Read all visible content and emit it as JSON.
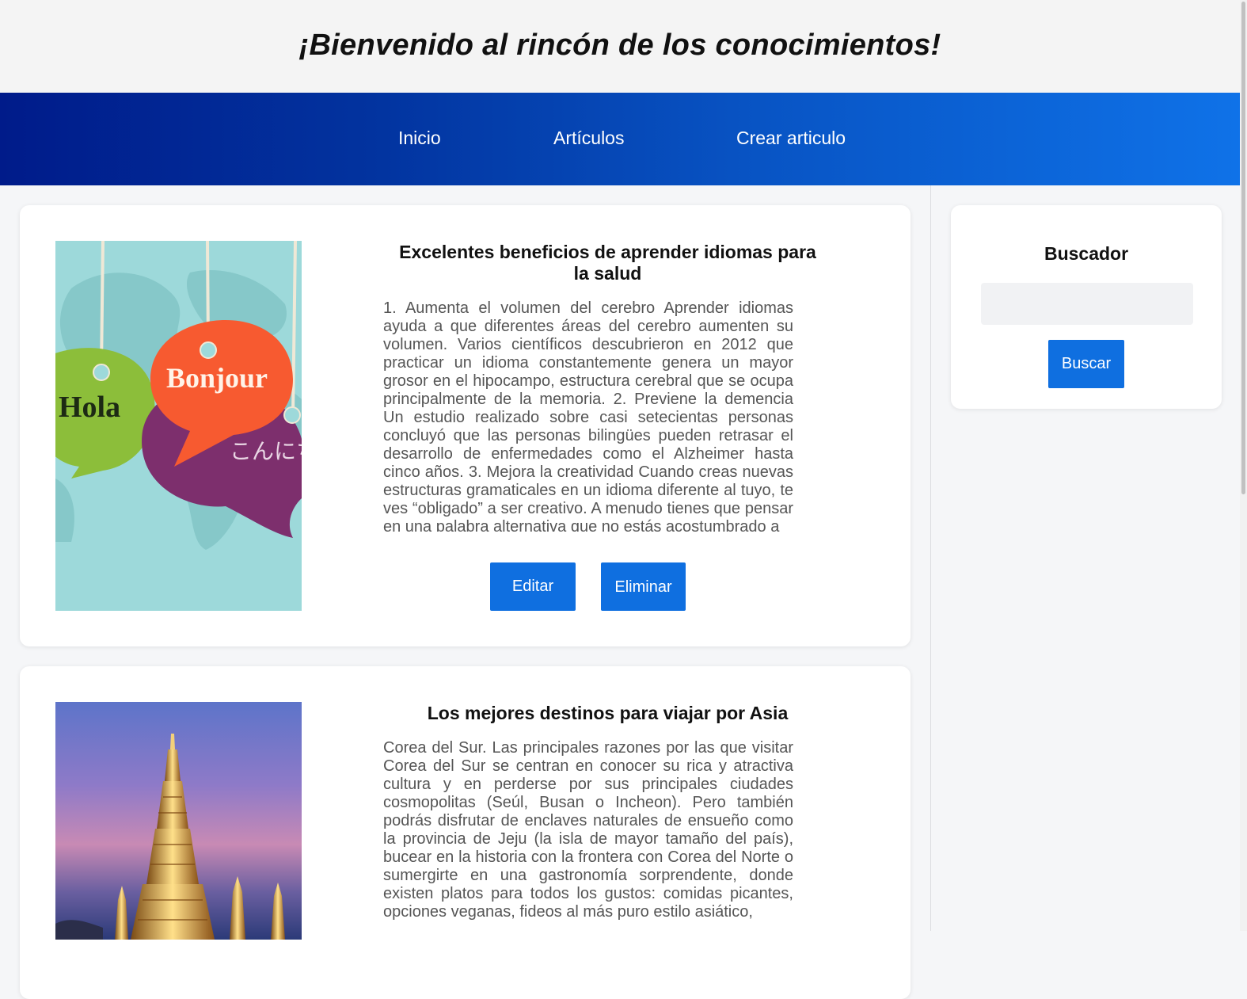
{
  "header": {
    "title": "¡Bienvenido al rincón de los conocimientos!"
  },
  "nav": {
    "items": [
      "Inicio",
      "Artículos",
      "Crear articulo"
    ]
  },
  "articles": [
    {
      "title": "Excelentes beneficios de aprender idiomas para la salud",
      "body": "1. Aumenta el volumen del cerebro Aprender idiomas ayuda a que diferentes áreas del cerebro aumenten su volumen. Varios científicos descubrieron en 2012 que practicar un idioma constantemente genera un mayor grosor en el hipocampo, estructura cerebral que se ocupa principalmente de la memoria. 2. Previene la demencia Un estudio realizado sobre casi setecientas personas concluyó que las personas bilingües pueden retrasar el desarrollo de enfermedades como el Alzheimer hasta cinco años. 3. Mejora la creatividad Cuando creas nuevas estructuras gramaticales en un idioma diferente al tuyo, te ves “obligado” a ser creativo. A menudo tienes que pensar en una palabra alternativa que no estás acostumbrado a",
      "image_words": [
        "Hola",
        "Bonjour",
        "こんにちは"
      ],
      "edit_label": "Editar",
      "delete_label": "Eliminar"
    },
    {
      "title": "Los mejores destinos para viajar por Asia",
      "body": "Corea del Sur. Las principales razones por las que visitar Corea del Sur se centran en conocer su rica y atractiva cultura y en perderse por sus principales ciudades cosmopolitas (Seúl, Busan o Incheon). Pero también podrás disfrutar de enclaves naturales de ensueño como la provincia de Jeju (la isla de mayor tamaño del país), bucear en la historia con la frontera con Corea del Norte o sumergirte en una gastronomía sorprendente, donde existen platos para todos los gustos: comidas picantes, opciones veganas, fideos al más puro estilo asiático,"
    }
  ],
  "sidebar": {
    "title": "Buscador",
    "search_placeholder": "",
    "search_button": "Buscar"
  },
  "colors": {
    "accent": "#0f6fe0",
    "nav_start": "#001b8a",
    "nav_end": "#0f72e8"
  }
}
